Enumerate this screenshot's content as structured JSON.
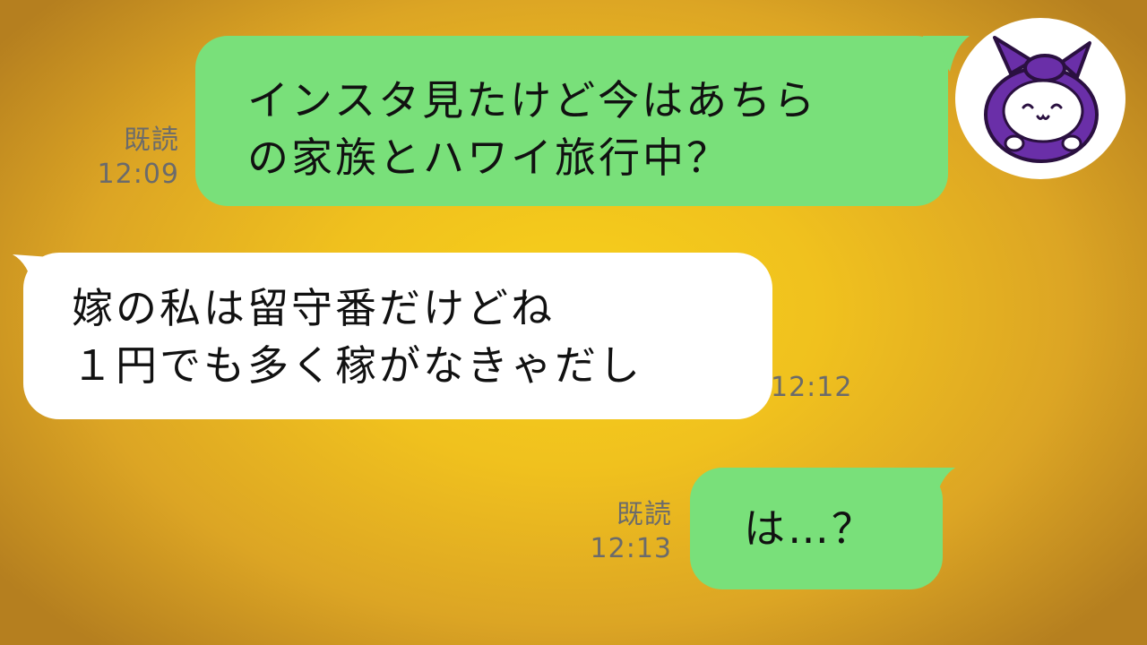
{
  "colors": {
    "background": "#f0c11e",
    "sent_bubble": "#79e07a",
    "received_bubble": "#ffffff",
    "meta_text": "#6b6b6b",
    "avatar_purple": "#6a2fa8"
  },
  "avatar": {
    "icon": "purple-cloth-wrapped-mascot-icon"
  },
  "messages": [
    {
      "direction": "sent",
      "lines": [
        "インスタ見たけど今はあちら",
        "の家族とハワイ旅行中？"
      ],
      "read_label": "既読",
      "time": "12:09"
    },
    {
      "direction": "received",
      "lines": [
        "嫁の私は留守番だけどね",
        "１円でも多く稼がなきゃだし"
      ],
      "time": "12:12"
    },
    {
      "direction": "sent",
      "lines": [
        "は…？"
      ],
      "read_label": "既読",
      "time": "12:13"
    }
  ]
}
